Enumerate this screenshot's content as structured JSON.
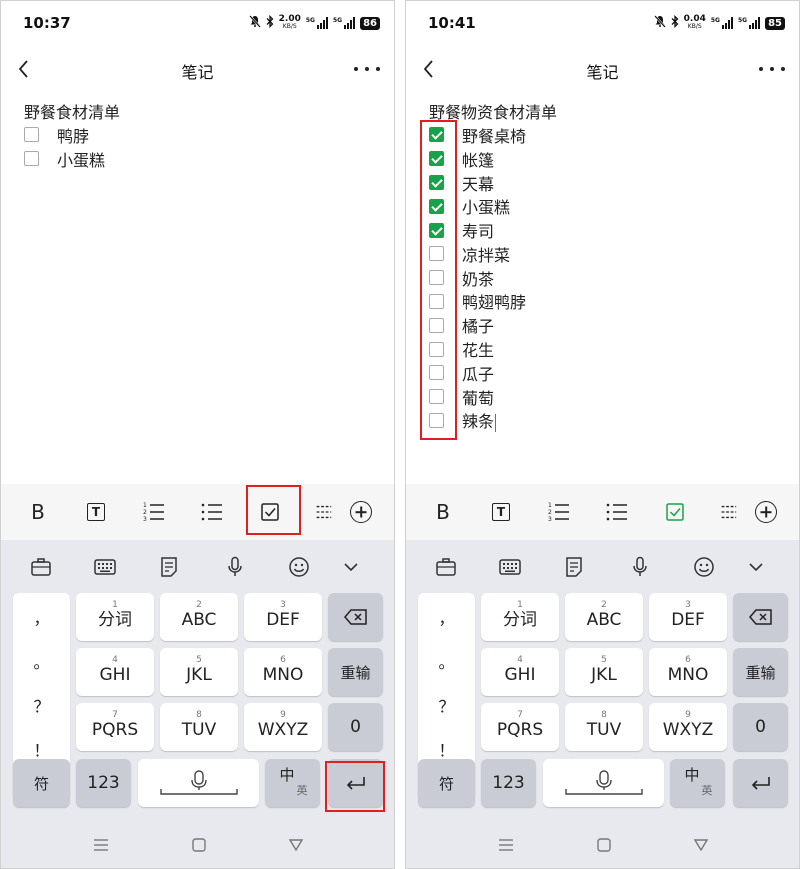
{
  "left": {
    "status": {
      "time": "10:37",
      "speed_value": "2.00",
      "speed_unit": "KB/S",
      "signal_label": "5G",
      "battery": "86"
    },
    "header": {
      "title": "笔记"
    },
    "note": {
      "title": "野餐食材清单",
      "items": [
        {
          "label": "鸭脖",
          "checked": false
        },
        {
          "label": "小蛋糕",
          "checked": false
        }
      ]
    }
  },
  "right": {
    "status": {
      "time": "10:41",
      "speed_value": "0.04",
      "speed_unit": "KB/S",
      "signal_label": "5G",
      "battery": "85"
    },
    "header": {
      "title": "笔记"
    },
    "note": {
      "title": "野餐物资食材清单",
      "items": [
        {
          "label": "野餐桌椅",
          "checked": true
        },
        {
          "label": "帐篷",
          "checked": true
        },
        {
          "label": "天幕",
          "checked": true
        },
        {
          "label": "小蛋糕",
          "checked": true
        },
        {
          "label": "寿司",
          "checked": true
        },
        {
          "label": "凉拌菜",
          "checked": false
        },
        {
          "label": "奶茶",
          "checked": false
        },
        {
          "label": "鸭翅鸭脖",
          "checked": false
        },
        {
          "label": "橘子",
          "checked": false
        },
        {
          "label": "花生",
          "checked": false
        },
        {
          "label": "瓜子",
          "checked": false
        },
        {
          "label": "葡萄",
          "checked": false
        },
        {
          "label": "辣条",
          "checked": false
        }
      ]
    }
  },
  "toolbar": {
    "bold_label": "B",
    "text_label": "T"
  },
  "keyboard": {
    "punctuation": [
      "，",
      "。",
      "？",
      "！"
    ],
    "keys": {
      "k1": {
        "num": "1",
        "label": "分词"
      },
      "k2": {
        "num": "2",
        "label": "ABC"
      },
      "k3": {
        "num": "3",
        "label": "DEF"
      },
      "k4": {
        "num": "4",
        "label": "GHI"
      },
      "k5": {
        "num": "5",
        "label": "JKL"
      },
      "k6": {
        "num": "6",
        "label": "MNO"
      },
      "k7": {
        "num": "7",
        "label": "PQRS"
      },
      "k8": {
        "num": "8",
        "label": "TUV"
      },
      "k9": {
        "num": "9",
        "label": "WXYZ"
      }
    },
    "reinput": "重输",
    "zero": "0",
    "symbol": "符",
    "numeric": "123",
    "lang_zh": "中",
    "lang_en": "英"
  },
  "colors": {
    "accent_green": "#18a34a",
    "highlight_red": "#e02020",
    "keyboard_bg": "#e8e9ee"
  },
  "icons": [
    "back-icon",
    "more-icon",
    "bold-icon",
    "text-style-icon",
    "numbered-list-icon",
    "bullet-list-icon",
    "checklist-icon",
    "divider-icon",
    "add-icon",
    "briefcase-icon",
    "keyboard-icon",
    "clipboard-icon",
    "microphone-icon",
    "emoji-icon",
    "collapse-icon",
    "backspace-icon",
    "enter-icon",
    "menu-icon",
    "home-icon",
    "back-nav-icon"
  ]
}
